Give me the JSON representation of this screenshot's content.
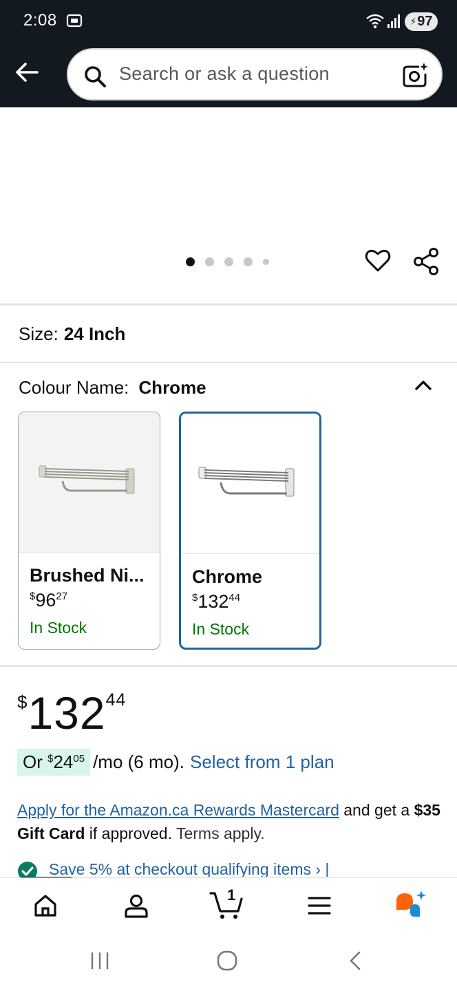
{
  "status_bar": {
    "time": "2:08",
    "battery": "97",
    "icons": [
      "screen-record-icon",
      "wifi-icon",
      "signal-icon",
      "battery-icon"
    ]
  },
  "header": {
    "search_placeholder": "Search or ask a question",
    "icons": [
      "back-arrow-icon",
      "search-icon",
      "camera-search-icon"
    ]
  },
  "gallery": {
    "dot_count": 5,
    "active_dot": 0,
    "icons": [
      "heart-icon",
      "share-icon"
    ]
  },
  "size": {
    "label": "Size:",
    "value": "24 Inch"
  },
  "colour": {
    "label": "Colour Name:",
    "value": "Chrome",
    "options": [
      {
        "name": "Brushed Ni...",
        "price_currency": "$",
        "price_whole": "96",
        "price_fraction": "27",
        "stock": "In Stock",
        "selected": false
      },
      {
        "name": "Chrome",
        "price_currency": "$",
        "price_whole": "132",
        "price_fraction": "44",
        "stock": "In Stock",
        "selected": true
      }
    ]
  },
  "price": {
    "currency": "$",
    "whole": "132",
    "fraction": "44"
  },
  "installment": {
    "prefix": "Or ",
    "currency": "$",
    "whole": "24",
    "fraction": "05",
    "suffix": "/mo (6 mo).",
    "link": "Select from 1 plan"
  },
  "rewards": {
    "link": "Apply for the Amazon.ca Rewards Mastercard",
    "text1": " and get a ",
    "bold": "$35 Gift Card",
    "text2": " if approved. ",
    "terms": "Terms apply."
  },
  "save": {
    "text": "Save 5% at checkout  qualifying items ›  |"
  },
  "bottom_nav": [
    "home-icon",
    "account-icon",
    "cart-icon",
    "menu-icon",
    "rufus-assistant-icon"
  ],
  "cart_count": "1",
  "system_nav": [
    "recent-apps-icon",
    "home-circle-icon",
    "back-chevron-icon"
  ],
  "colors": {
    "header_bg": "#131921",
    "link": "#2162a1",
    "in_stock": "#007600",
    "selected_border": "#2162a1",
    "installment_bg": "#d7f5ea",
    "rufus_orange": "#ff6200",
    "rufus_blue": "#1a8dd9"
  }
}
